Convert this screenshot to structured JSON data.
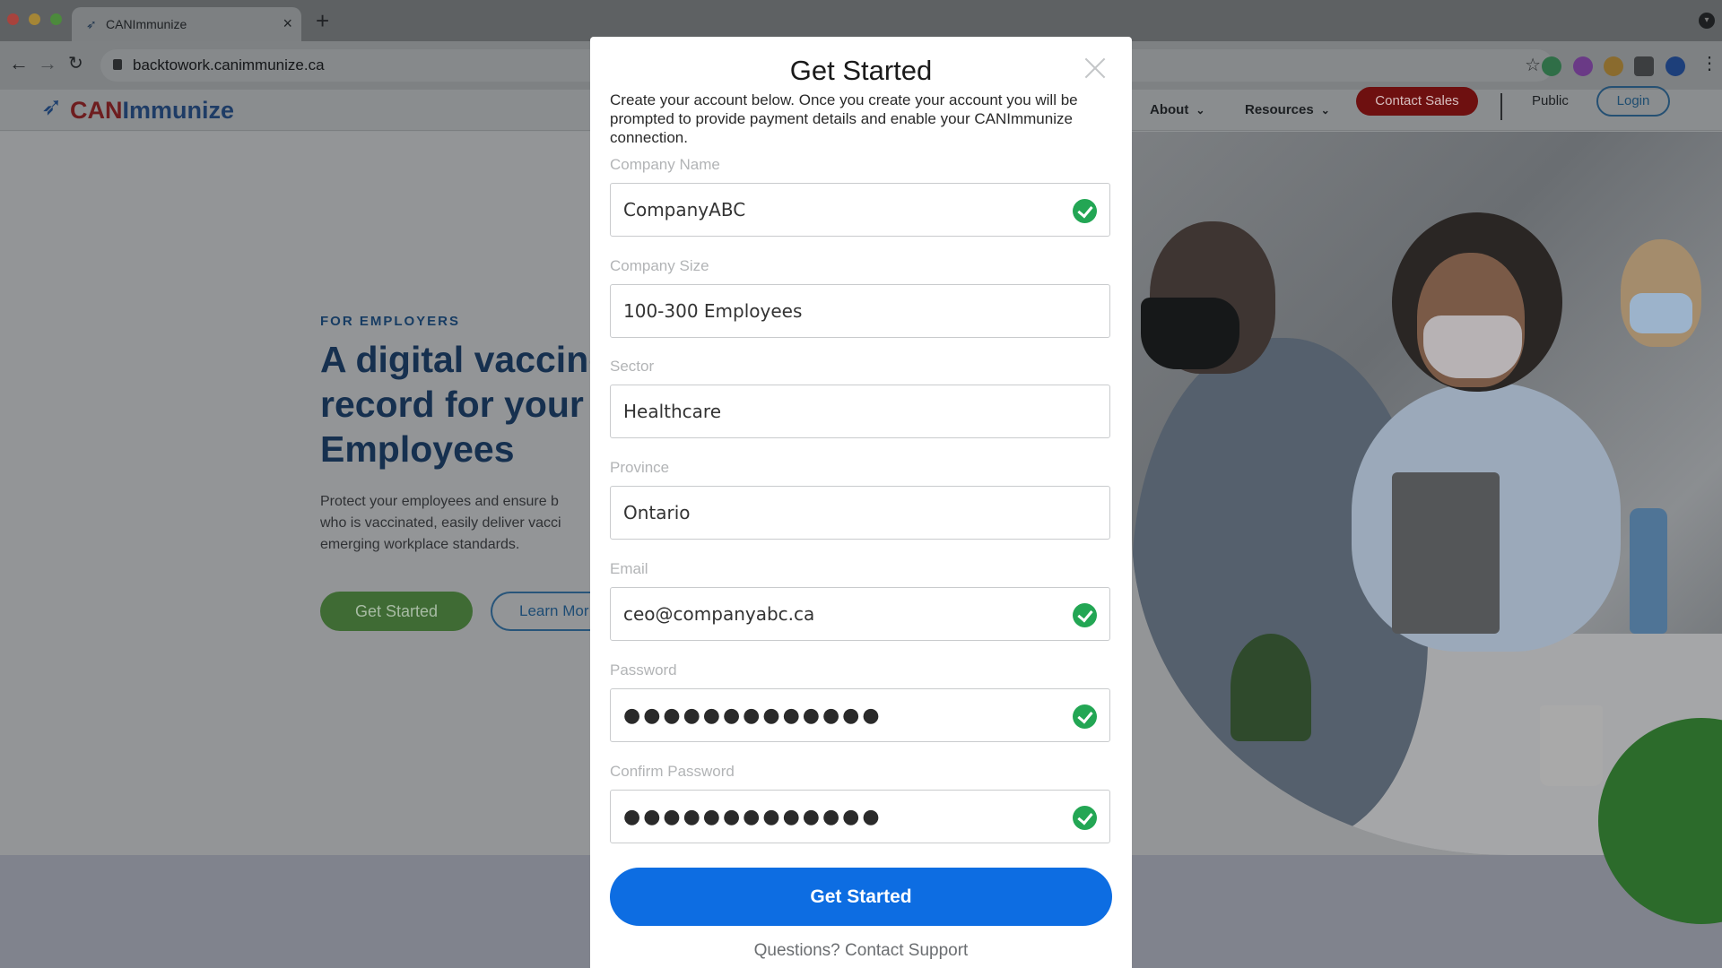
{
  "browser": {
    "tab_title": "CANImmunize",
    "url": "backtowork.canimmunize.ca",
    "new_tab_symbol": "+"
  },
  "site": {
    "logo_can": "CAN",
    "logo_immunize": "Immunize",
    "nav": {
      "about": "About",
      "resources": "Resources",
      "contact_sales": "Contact Sales",
      "public": "Public",
      "login": "Login"
    },
    "hero": {
      "kicker": "FOR EMPLOYERS",
      "headline_line1": "A digital vaccine",
      "headline_line2": "record for your",
      "headline_line3": "Employees",
      "desc_line1": "Protect your employees and ensure b",
      "desc_line2": "who is vaccinated, easily deliver vacci",
      "desc_line3": "emerging workplace standards.",
      "get_started": "Get Started",
      "learn_more": "Learn Mor"
    }
  },
  "modal": {
    "title": "Get Started",
    "description": "Create your account below. Once you create your account you will be prompted to provide payment details and enable your CANImmunize connection.",
    "fields": {
      "company_name": {
        "label": "Company Name",
        "value": "CompanyABC"
      },
      "company_size": {
        "label": "Company Size",
        "value": "100-300 Employees"
      },
      "sector": {
        "label": "Sector",
        "value": "Healthcare"
      },
      "province": {
        "label": "Province",
        "value": "Ontario"
      },
      "email": {
        "label": "Email",
        "value": "ceo@companyabc.ca"
      },
      "password": {
        "label": "Password",
        "value": "●●●●●●●●●●●●●"
      },
      "confirm_password": {
        "label": "Confirm Password",
        "value": "●●●●●●●●●●●●●"
      }
    },
    "submit_label": "Get Started",
    "support_text": "Questions? Contact Support"
  },
  "colors": {
    "primary_button": "#0d6de2",
    "valid_check": "#23a654",
    "contact_sales": "#cc1f1f",
    "brand_navy": "#1e3c66"
  },
  "icons": [
    "back-icon",
    "forward-icon",
    "reload-icon",
    "lock-icon",
    "bookmark-star-icon",
    "close-icon",
    "checkmark-icon",
    "chevron-down-icon"
  ]
}
